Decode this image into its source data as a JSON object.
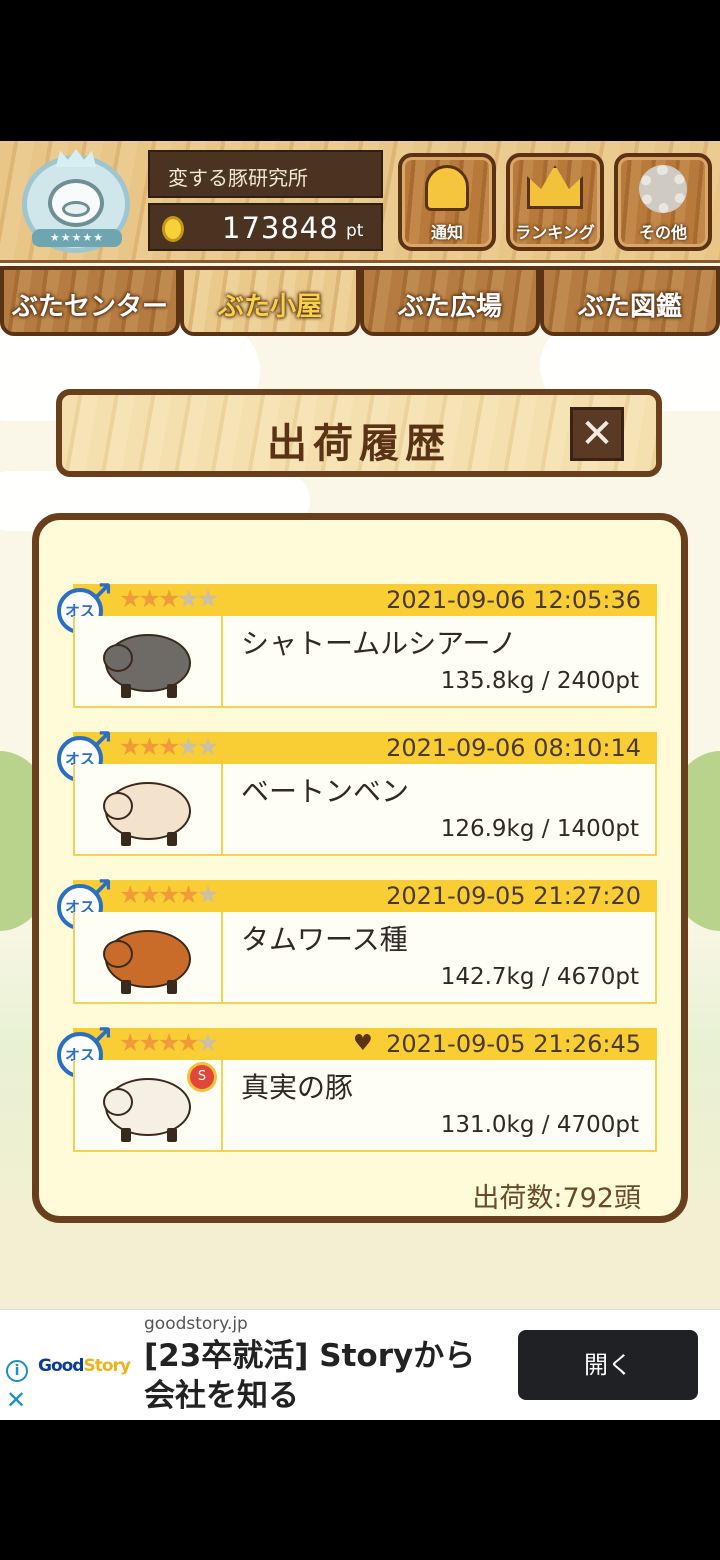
{
  "header": {
    "lab_name": "変する豚研究所",
    "points": "173848",
    "points_unit": "pt",
    "buttons": [
      {
        "label": "通知",
        "icon": "bell-icon"
      },
      {
        "label": "ランキング",
        "icon": "crown-icon"
      },
      {
        "label": "その他",
        "icon": "gear-icon"
      }
    ]
  },
  "tabs": [
    {
      "label": "ぶたセンター",
      "active": false
    },
    {
      "label": "ぶた小屋",
      "active": true
    },
    {
      "label": "ぶた広場",
      "active": false
    },
    {
      "label": "ぶた図鑑",
      "active": false
    }
  ],
  "dialog": {
    "title": "出荷履歴",
    "close_label": "✕",
    "records": [
      {
        "gender": "オス",
        "stars": 3,
        "max_stars": 5,
        "date": "2021-09-06 12:05:36",
        "name": "シャトームルシアーノ",
        "stats": "135.8kg / 2400pt",
        "pig_color": "#6e6a66",
        "favorite": false,
        "medal": ""
      },
      {
        "gender": "オス",
        "stars": 3,
        "max_stars": 5,
        "date": "2021-09-06 08:10:14",
        "name": "ベートンベン",
        "stats": "126.9kg / 1400pt",
        "pig_color": "#f3e3cc",
        "favorite": false,
        "medal": ""
      },
      {
        "gender": "オス",
        "stars": 4,
        "max_stars": 5,
        "date": "2021-09-05 21:27:20",
        "name": "タムワース種",
        "stats": "142.7kg / 4670pt",
        "pig_color": "#c96c2a",
        "favorite": false,
        "medal": ""
      },
      {
        "gender": "オス",
        "stars": 4,
        "max_stars": 5,
        "date": "2021-09-05 21:26:45",
        "name": "真実の豚",
        "stats": "131.0kg / 4700pt",
        "pig_color": "#f6efe3",
        "favorite": true,
        "medal": "S"
      }
    ],
    "shipment_count": "出荷数:792頭"
  },
  "ad": {
    "domain": "goodstory.jp",
    "logo_part1": "Good",
    "logo_part2": "Story",
    "text": "[23卒就活] Storyから会社を知る",
    "button_label": "開く",
    "info_label": "i",
    "close_label": "✕"
  }
}
